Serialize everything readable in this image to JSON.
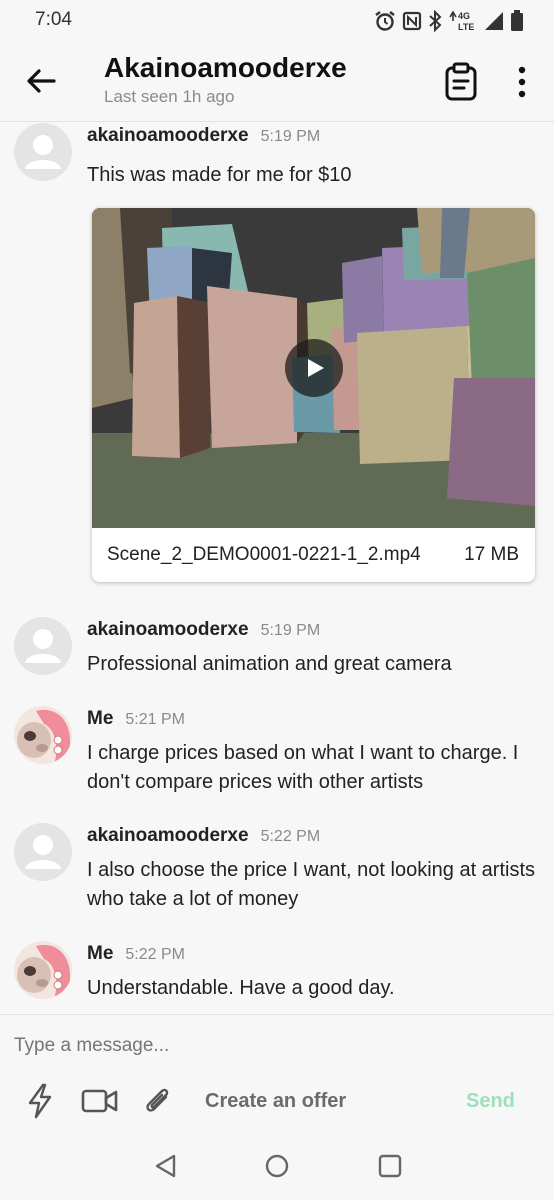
{
  "status_bar": {
    "time": "7:04",
    "icons": [
      "alarm-icon",
      "nfc-icon",
      "bluetooth-icon",
      "4g-lte-icon",
      "signal-icon",
      "battery-icon"
    ],
    "network_label_top": "4G",
    "network_label_bottom": "LTE"
  },
  "header": {
    "back_icon": "arrow-left-icon",
    "title": "Akainoamooderxe",
    "subtitle": "Last seen 1h ago",
    "clipboard_icon": "clipboard-icon",
    "more_icon": "more-vertical-icon"
  },
  "messages": [
    {
      "sender": "akainoamooderxe",
      "time": "5:19 PM",
      "text": "This was made for me for $10",
      "avatar": "default-avatar",
      "attachment": {
        "file_name": "Scene_2_DEMO0001-0221-1_2.mp4",
        "file_size": "17 MB",
        "icon": "play-icon"
      }
    },
    {
      "sender": "akainoamooderxe",
      "time": "5:19 PM",
      "text": "Professional animation and great camera",
      "avatar": "default-avatar"
    },
    {
      "sender": "Me",
      "time": "5:21 PM",
      "text": "I charge prices based on what I want to charge. I don't compare prices with other artists",
      "avatar": "anime-avatar"
    },
    {
      "sender": "akainoamooderxe",
      "time": "5:22 PM",
      "text": "I also choose the price I want, not looking at artists who take a lot of money",
      "avatar": "default-avatar"
    },
    {
      "sender": "Me",
      "time": "5:22 PM",
      "text": "Understandable. Have a good day.",
      "avatar": "anime-avatar"
    }
  ],
  "composer": {
    "placeholder": "Type a message...",
    "tools": [
      "lightning-icon",
      "video-camera-icon",
      "paperclip-icon"
    ],
    "offer_label": "Create an offer",
    "send_label": "Send"
  },
  "nav_bar": {
    "icons": [
      "back-triangle-icon",
      "home-circle-icon",
      "recents-square-icon"
    ]
  },
  "colors": {
    "background": "#f7f7f7",
    "send_disabled": "#9fe0bc",
    "muted_text": "#8a8a8a"
  }
}
